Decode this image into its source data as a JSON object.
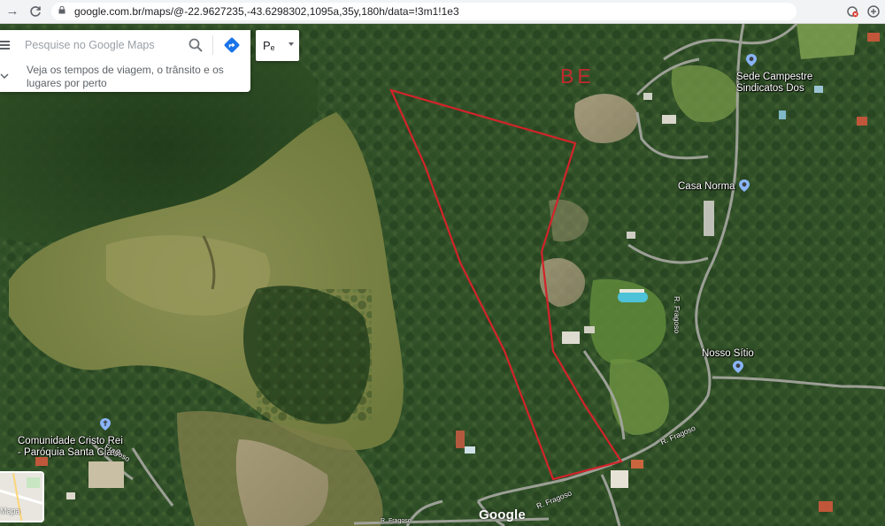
{
  "browser": {
    "url": "google.com.br/maps/@-22.9627235,-43.6298302,1095a,35y,180h/data=!3m1!1e3",
    "back_icon": "arrow-right-icon",
    "reload_icon": "reload-icon"
  },
  "search": {
    "placeholder": "Pesquise no Google Maps",
    "hint": "Veja os tempos de viagem, o trânsito e os lugares por perto"
  },
  "layer_button": {
    "label": "Pₑ"
  },
  "minimap": {
    "label": "Mapa"
  },
  "map": {
    "logo": "Google",
    "annotation": "BE",
    "boundary_color": "#d3232a",
    "places": {
      "sede": [
        "Sede Campestre",
        "Sindicatos Dos"
      ],
      "casa_norma": "Casa Norma",
      "nosso_sitio": "Nosso Sítio",
      "comunidade": [
        "Comunidade Cristo Rei",
        "- Paróquia Santa Clara"
      ]
    },
    "roads": {
      "fragoso_vertical": "R. Fragoso",
      "fragoso_mid": "R. Fragoso",
      "fragoso_bottom": "R. Fragoso",
      "fragoso_left": "Fragoso",
      "bottom_edge": "R. Fragoso"
    }
  }
}
